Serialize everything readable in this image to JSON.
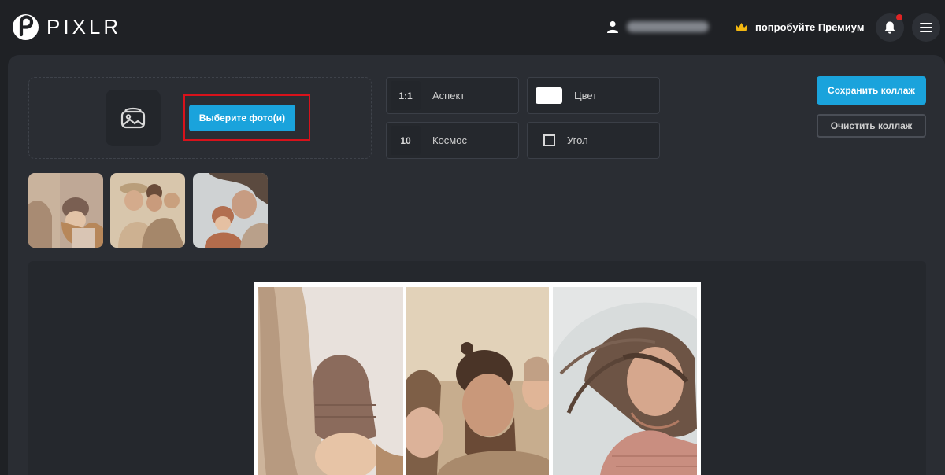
{
  "header": {
    "logo_text": "PIXLR",
    "user_name": "Ivana Ivanova",
    "premium_label": "попробуйте Премиум",
    "icons": {
      "logo": "pixlr-logo-icon",
      "user": "user-icon",
      "premium": "crown-icon",
      "bell": "bell-icon",
      "menu": "hamburger-menu-icon"
    },
    "notification_dot_color": "#e02424"
  },
  "upload": {
    "choose_label": "Выберите фото(и)",
    "icon": "image-icon",
    "highlight_color": "#d8121b"
  },
  "options": {
    "aspect": {
      "value": "1:1",
      "label": "Аспект"
    },
    "color": {
      "label": "Цвет",
      "swatch": "#ffffff"
    },
    "spacing": {
      "value": "10",
      "label": "Космос"
    },
    "corner": {
      "label": "Угол"
    }
  },
  "actions": {
    "save_label": "Сохранить коллаж",
    "clear_label": "Очистить коллаж"
  },
  "thumbnails": [
    "photo-mother-child-hat",
    "photo-family-kiss",
    "photo-mother-baby-wind"
  ],
  "collage_cells": [
    "photo-beige-coat-knit-hat",
    "photo-father-kiss-child",
    "photo-woman-windblown-hair"
  ],
  "colors": {
    "accent": "#1aa3dc",
    "background": "#1f2125",
    "panel": "#2a2d33"
  }
}
